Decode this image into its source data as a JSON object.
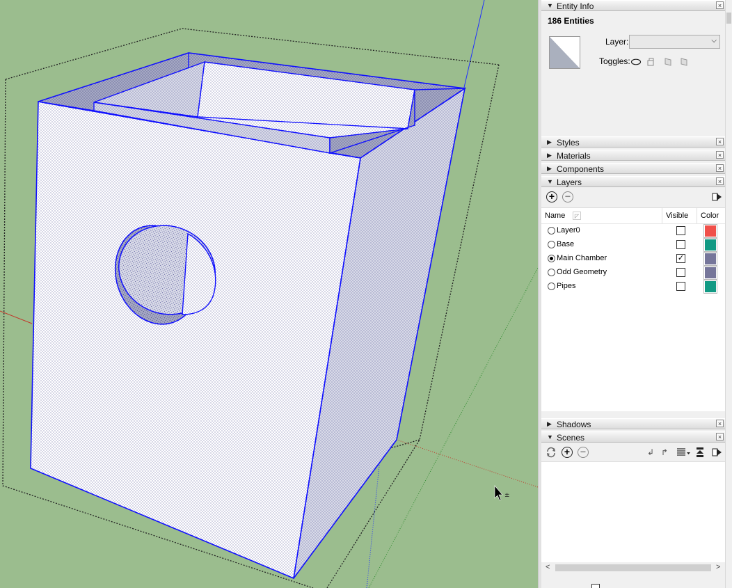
{
  "entity_info": {
    "title": "Entity Info",
    "count": "186 Entities",
    "layer_label": "Layer:",
    "layer_value": "",
    "toggles_label": "Toggles:"
  },
  "trays": {
    "styles": "Styles",
    "materials": "Materials",
    "components": "Components",
    "layers": "Layers",
    "shadows": "Shadows",
    "scenes": "Scenes"
  },
  "layers_panel": {
    "col_name": "Name",
    "col_visible": "Visible",
    "col_color": "Color",
    "rows": [
      {
        "name": "Layer0",
        "active": false,
        "visible": false,
        "color": "#f0504a"
      },
      {
        "name": "Base",
        "active": false,
        "visible": false,
        "color": "#129a84"
      },
      {
        "name": "Main Chamber",
        "active": true,
        "visible": true,
        "color": "#76769a"
      },
      {
        "name": "Odd Geometry",
        "active": false,
        "visible": false,
        "color": "#76769a"
      },
      {
        "name": "Pipes",
        "active": false,
        "visible": false,
        "color": "#129a84"
      }
    ]
  },
  "colors": {
    "viewport_bg": "#9bbd8e",
    "edge_blue": "#1010ff",
    "panel_bg": "#f0f0f0"
  }
}
